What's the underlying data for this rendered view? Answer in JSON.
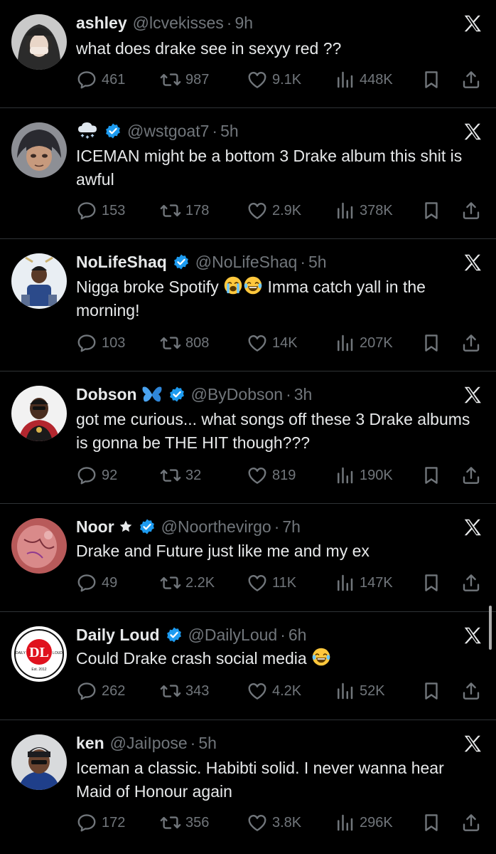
{
  "tweets": [
    {
      "name": "ashley",
      "handle": "@lcvekisses",
      "sep": "·",
      "time": "9h",
      "verified": false,
      "name_icon": "",
      "text_parts": [
        "what does drake see in sexyy red ??"
      ],
      "replies": "461",
      "reposts": "987",
      "likes": "9.1K",
      "views": "448K"
    },
    {
      "name": "",
      "handle": "@wstgoat7",
      "sep": "·",
      "time": "5h",
      "verified": true,
      "name_icon": "snow-cloud-icon",
      "text_parts": [
        "ICEMAN might be a bottom 3 Drake album this shit is awful"
      ],
      "replies": "153",
      "reposts": "178",
      "likes": "2.9K",
      "views": "378K"
    },
    {
      "name": "NoLifeShaq",
      "handle": "@NoLifeShaq",
      "sep": "·",
      "time": "5h",
      "verified": true,
      "name_icon": "",
      "text_parts": [
        "Nigga broke Spotify",
        "Imma catch yall in the morning!"
      ],
      "emojis": [
        "loudly-crying-face-emoji",
        "tears-of-joy-emoji"
      ],
      "replies": "103",
      "reposts": "808",
      "likes": "14K",
      "views": "207K"
    },
    {
      "name": "Dobson",
      "handle": "@ByDobson",
      "sep": "·",
      "time": "3h",
      "verified": true,
      "name_icon": "butterfly-icon",
      "text_parts": [
        "got me curious... what songs off these 3 Drake albums is gonna be THE HIT though???"
      ],
      "replies": "92",
      "reposts": "32",
      "likes": "819",
      "views": "190K"
    },
    {
      "name": "Noor",
      "handle": "@Noorthevirgo",
      "sep": "·",
      "time": "7h",
      "verified": true,
      "name_icon": "star-icon",
      "text_parts": [
        "Drake and Future just like me and my ex"
      ],
      "replies": "49",
      "reposts": "2.2K",
      "likes": "11K",
      "views": "147K"
    },
    {
      "name": "Daily Loud",
      "handle": "@DailyLoud",
      "sep": "·",
      "time": "6h",
      "verified": true,
      "name_icon": "",
      "text_parts": [
        "Could Drake crash social media"
      ],
      "emojis": [
        "tears-of-joy-emoji"
      ],
      "replies": "262",
      "reposts": "343",
      "likes": "4.2K",
      "views": "52K",
      "avatar_logo": {
        "top": "DAILY",
        "right": "LOUD",
        "letters": "DL",
        "est": "Est. 2012"
      }
    },
    {
      "name": "ken",
      "handle": "@JaiIpose",
      "sep": "·",
      "time": "5h",
      "verified": false,
      "name_icon": "",
      "text_parts": [
        "Iceman a classic. Habibti solid. I never wanna hear Maid of Honour again"
      ],
      "replies": "172",
      "reposts": "356",
      "likes": "3.8K",
      "views": "296K"
    }
  ],
  "colors": {
    "background": "#000000",
    "text": "#e7e9ea",
    "muted": "#71767b",
    "verified": "#1d9bf0",
    "divider": "#2f3336"
  }
}
